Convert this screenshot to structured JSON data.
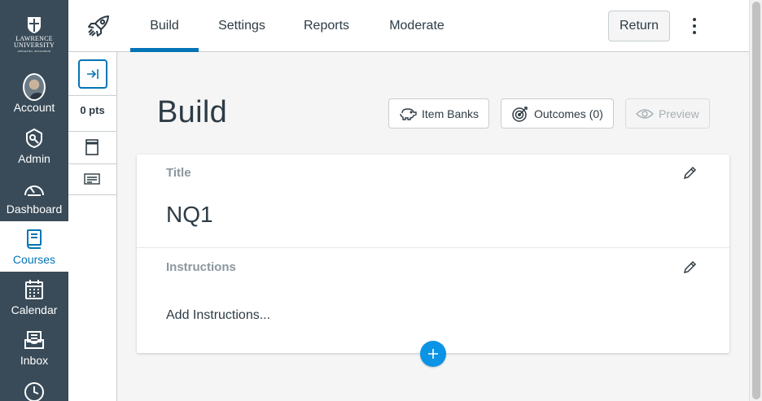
{
  "school": {
    "name_line1": "LAWRENCE",
    "name_line2": "UNIVERSITY",
    "subline": "APPLETON, WISCONSIN"
  },
  "global_nav": {
    "items": [
      {
        "label": "Account",
        "icon": "avatar"
      },
      {
        "label": "Admin",
        "icon": "admin-icon"
      },
      {
        "label": "Dashboard",
        "icon": "dashboard-icon"
      },
      {
        "label": "Courses",
        "icon": "courses-icon",
        "active": true
      },
      {
        "label": "Calendar",
        "icon": "calendar-icon"
      },
      {
        "label": "Inbox",
        "icon": "inbox-icon"
      }
    ]
  },
  "tabs": [
    {
      "label": "Build",
      "active": true
    },
    {
      "label": "Settings"
    },
    {
      "label": "Reports"
    },
    {
      "label": "Moderate"
    }
  ],
  "header": {
    "return_label": "Return"
  },
  "question_nav": {
    "points": "0 pts"
  },
  "main": {
    "title": "Build",
    "item_banks_label": "Item Banks",
    "outcomes_label": "Outcomes (0)",
    "preview_label": "Preview"
  },
  "quiz": {
    "title_label": "Title",
    "title_value": "NQ1",
    "instructions_label": "Instructions",
    "instructions_placeholder": "Add Instructions..."
  },
  "colors": {
    "nav_bg": "#394b58",
    "accent": "#0374b5",
    "add_button": "#0b93e6",
    "text": "#2d3b45",
    "muted": "#8b969e"
  }
}
